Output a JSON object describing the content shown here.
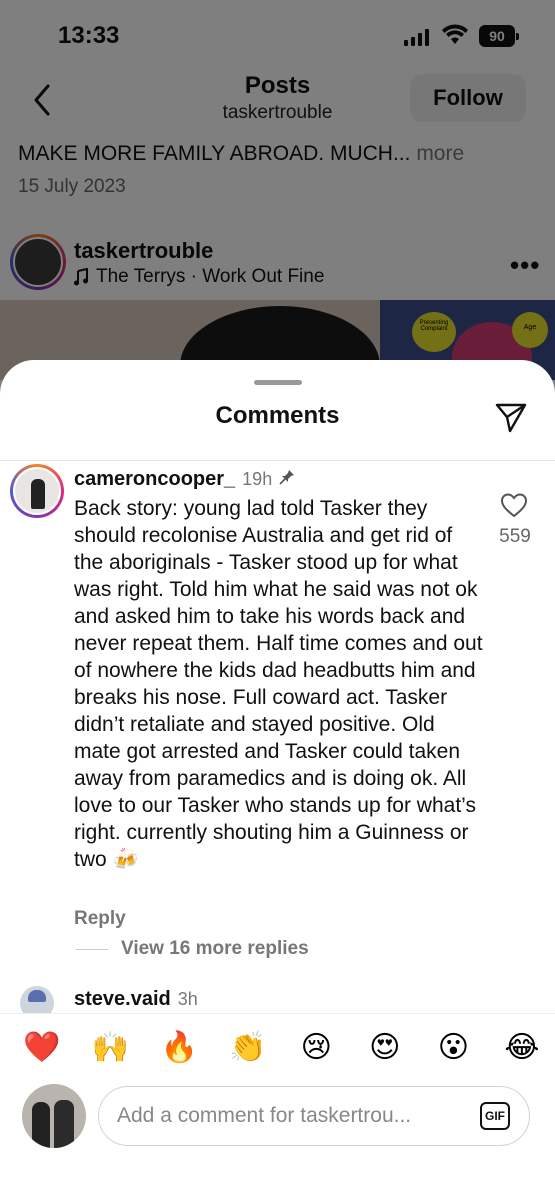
{
  "status_bar": {
    "time": "13:33",
    "battery": "90"
  },
  "nav": {
    "title": "Posts",
    "subtitle": "taskertrouble",
    "follow_label": "Follow"
  },
  "post": {
    "caption": "MAKE MORE FAMILY ABROAD. MUCH...",
    "caption_more": "more",
    "date": "15 July 2023",
    "username": "taskertrouble",
    "music": "The Terrys · Work Out Fine",
    "slide_label_1": "Presenting Complaint",
    "slide_label_2": "Age"
  },
  "comments_sheet": {
    "title": "Comments",
    "comments": [
      {
        "username": "cameroncooper_",
        "time": "19h",
        "text": "Back story: young lad told Tasker they should recolonise Australia and get rid of the aboriginals - Tasker stood up for what was right. Told him what he said was not ok and asked him to take his words back and never repeat them. Half time comes and out of nowhere the kids dad headbutts him and breaks his nose. Full coward act. Tasker didn’t retaliate and stayed positive. Old mate got arrested and Tasker could taken away from paramedics and is doing ok. All love to our Tasker who stands up for what’s right. currently shouting him a Guinness or two 🍻",
        "likes": "559",
        "reply_label": "Reply",
        "view_replies": "View 16 more replies"
      },
      {
        "username": "steve.vaid",
        "time": "3h"
      }
    ],
    "emoji_bar": [
      "❤️",
      "🙌",
      "🔥",
      "👏",
      "😢",
      "😍",
      "😮",
      "😂"
    ],
    "input_placeholder": "Add a comment for taskertrou...",
    "gif_label": "GIF"
  }
}
